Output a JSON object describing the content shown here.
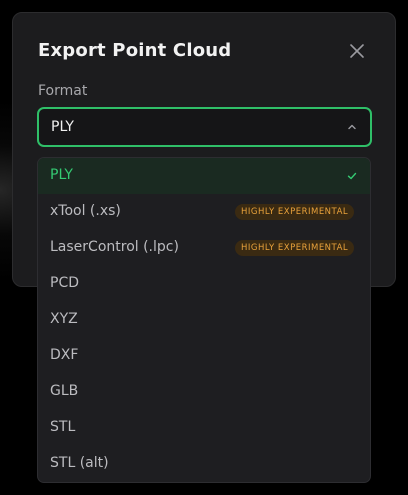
{
  "dialog": {
    "title": "Export Point Cloud",
    "close_icon": "close-icon"
  },
  "format": {
    "label": "Format",
    "selected_value": "PLY",
    "chevron_icon": "chevron-up-icon"
  },
  "dropdown": {
    "options": [
      {
        "label": "PLY",
        "selected": true,
        "badge": ""
      },
      {
        "label": "xTool (.xs)",
        "selected": false,
        "badge": "HIGHLY EXPERIMENTAL"
      },
      {
        "label": "LaserControl (.lpc)",
        "selected": false,
        "badge": "HIGHLY EXPERIMENTAL"
      },
      {
        "label": "PCD",
        "selected": false,
        "badge": ""
      },
      {
        "label": "XYZ",
        "selected": false,
        "badge": ""
      },
      {
        "label": "DXF",
        "selected": false,
        "badge": ""
      },
      {
        "label": "GLB",
        "selected": false,
        "badge": ""
      },
      {
        "label": "STL",
        "selected": false,
        "badge": ""
      },
      {
        "label": "STL (alt)",
        "selected": false,
        "badge": ""
      }
    ],
    "check_icon": "check-icon"
  },
  "colors": {
    "accent_green": "#2fbf68",
    "badge_text": "#e9a23b",
    "badge_bg": "#3a2a12",
    "panel_bg": "#1c1c1e"
  }
}
